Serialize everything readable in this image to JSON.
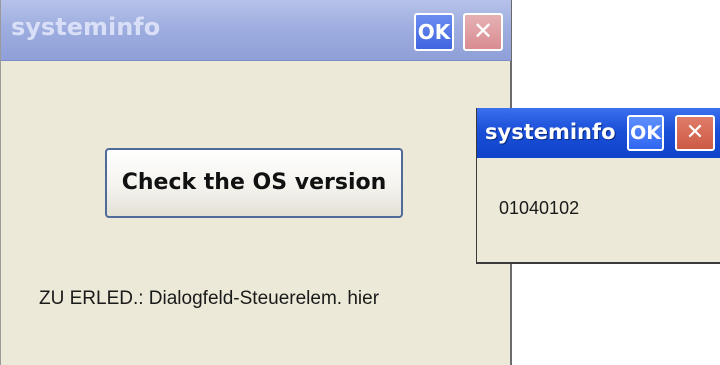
{
  "main_window": {
    "title": "systeminfo",
    "ok_label": "OK",
    "close_glyph": "✕",
    "check_button_label": "Check the OS version",
    "static_text": "ZU ERLED.: Dialogfeld-Steuerelem. hier"
  },
  "popup_window": {
    "title": "systeminfo",
    "ok_label": "OK",
    "close_glyph": "✕",
    "value": "01040102"
  },
  "colors": {
    "inactive_titlebar": "#9faee0",
    "active_titlebar": "#1a4fd8",
    "dialog_background": "#ece9d8",
    "close_inactive": "#d98c91",
    "close_active": "#cd5a44"
  },
  "icons": {
    "close": "close-icon"
  }
}
